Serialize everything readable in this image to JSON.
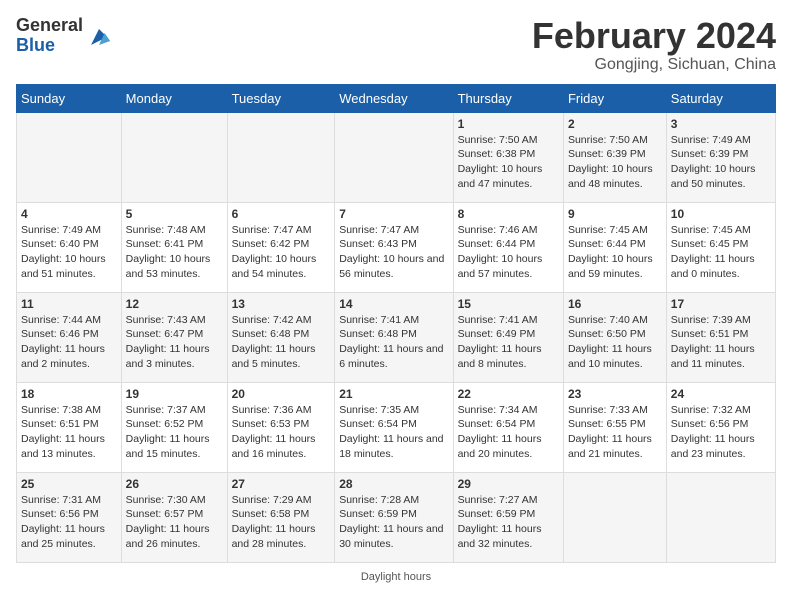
{
  "header": {
    "logo_general": "General",
    "logo_blue": "Blue",
    "title": "February 2024",
    "subtitle": "Gongjing, Sichuan, China"
  },
  "days_of_week": [
    "Sunday",
    "Monday",
    "Tuesday",
    "Wednesday",
    "Thursday",
    "Friday",
    "Saturday"
  ],
  "weeks": [
    [
      {
        "day": "",
        "info": ""
      },
      {
        "day": "",
        "info": ""
      },
      {
        "day": "",
        "info": ""
      },
      {
        "day": "",
        "info": ""
      },
      {
        "day": "1",
        "info": "Sunrise: 7:50 AM\nSunset: 6:38 PM\nDaylight: 10 hours and 47 minutes."
      },
      {
        "day": "2",
        "info": "Sunrise: 7:50 AM\nSunset: 6:39 PM\nDaylight: 10 hours and 48 minutes."
      },
      {
        "day": "3",
        "info": "Sunrise: 7:49 AM\nSunset: 6:39 PM\nDaylight: 10 hours and 50 minutes."
      }
    ],
    [
      {
        "day": "4",
        "info": "Sunrise: 7:49 AM\nSunset: 6:40 PM\nDaylight: 10 hours and 51 minutes."
      },
      {
        "day": "5",
        "info": "Sunrise: 7:48 AM\nSunset: 6:41 PM\nDaylight: 10 hours and 53 minutes."
      },
      {
        "day": "6",
        "info": "Sunrise: 7:47 AM\nSunset: 6:42 PM\nDaylight: 10 hours and 54 minutes."
      },
      {
        "day": "7",
        "info": "Sunrise: 7:47 AM\nSunset: 6:43 PM\nDaylight: 10 hours and 56 minutes."
      },
      {
        "day": "8",
        "info": "Sunrise: 7:46 AM\nSunset: 6:44 PM\nDaylight: 10 hours and 57 minutes."
      },
      {
        "day": "9",
        "info": "Sunrise: 7:45 AM\nSunset: 6:44 PM\nDaylight: 10 hours and 59 minutes."
      },
      {
        "day": "10",
        "info": "Sunrise: 7:45 AM\nSunset: 6:45 PM\nDaylight: 11 hours and 0 minutes."
      }
    ],
    [
      {
        "day": "11",
        "info": "Sunrise: 7:44 AM\nSunset: 6:46 PM\nDaylight: 11 hours and 2 minutes."
      },
      {
        "day": "12",
        "info": "Sunrise: 7:43 AM\nSunset: 6:47 PM\nDaylight: 11 hours and 3 minutes."
      },
      {
        "day": "13",
        "info": "Sunrise: 7:42 AM\nSunset: 6:48 PM\nDaylight: 11 hours and 5 minutes."
      },
      {
        "day": "14",
        "info": "Sunrise: 7:41 AM\nSunset: 6:48 PM\nDaylight: 11 hours and 6 minutes."
      },
      {
        "day": "15",
        "info": "Sunrise: 7:41 AM\nSunset: 6:49 PM\nDaylight: 11 hours and 8 minutes."
      },
      {
        "day": "16",
        "info": "Sunrise: 7:40 AM\nSunset: 6:50 PM\nDaylight: 11 hours and 10 minutes."
      },
      {
        "day": "17",
        "info": "Sunrise: 7:39 AM\nSunset: 6:51 PM\nDaylight: 11 hours and 11 minutes."
      }
    ],
    [
      {
        "day": "18",
        "info": "Sunrise: 7:38 AM\nSunset: 6:51 PM\nDaylight: 11 hours and 13 minutes."
      },
      {
        "day": "19",
        "info": "Sunrise: 7:37 AM\nSunset: 6:52 PM\nDaylight: 11 hours and 15 minutes."
      },
      {
        "day": "20",
        "info": "Sunrise: 7:36 AM\nSunset: 6:53 PM\nDaylight: 11 hours and 16 minutes."
      },
      {
        "day": "21",
        "info": "Sunrise: 7:35 AM\nSunset: 6:54 PM\nDaylight: 11 hours and 18 minutes."
      },
      {
        "day": "22",
        "info": "Sunrise: 7:34 AM\nSunset: 6:54 PM\nDaylight: 11 hours and 20 minutes."
      },
      {
        "day": "23",
        "info": "Sunrise: 7:33 AM\nSunset: 6:55 PM\nDaylight: 11 hours and 21 minutes."
      },
      {
        "day": "24",
        "info": "Sunrise: 7:32 AM\nSunset: 6:56 PM\nDaylight: 11 hours and 23 minutes."
      }
    ],
    [
      {
        "day": "25",
        "info": "Sunrise: 7:31 AM\nSunset: 6:56 PM\nDaylight: 11 hours and 25 minutes."
      },
      {
        "day": "26",
        "info": "Sunrise: 7:30 AM\nSunset: 6:57 PM\nDaylight: 11 hours and 26 minutes."
      },
      {
        "day": "27",
        "info": "Sunrise: 7:29 AM\nSunset: 6:58 PM\nDaylight: 11 hours and 28 minutes."
      },
      {
        "day": "28",
        "info": "Sunrise: 7:28 AM\nSunset: 6:59 PM\nDaylight: 11 hours and 30 minutes."
      },
      {
        "day": "29",
        "info": "Sunrise: 7:27 AM\nSunset: 6:59 PM\nDaylight: 11 hours and 32 minutes."
      },
      {
        "day": "",
        "info": ""
      },
      {
        "day": "",
        "info": ""
      }
    ]
  ],
  "footer": {
    "daylight_label": "Daylight hours"
  }
}
